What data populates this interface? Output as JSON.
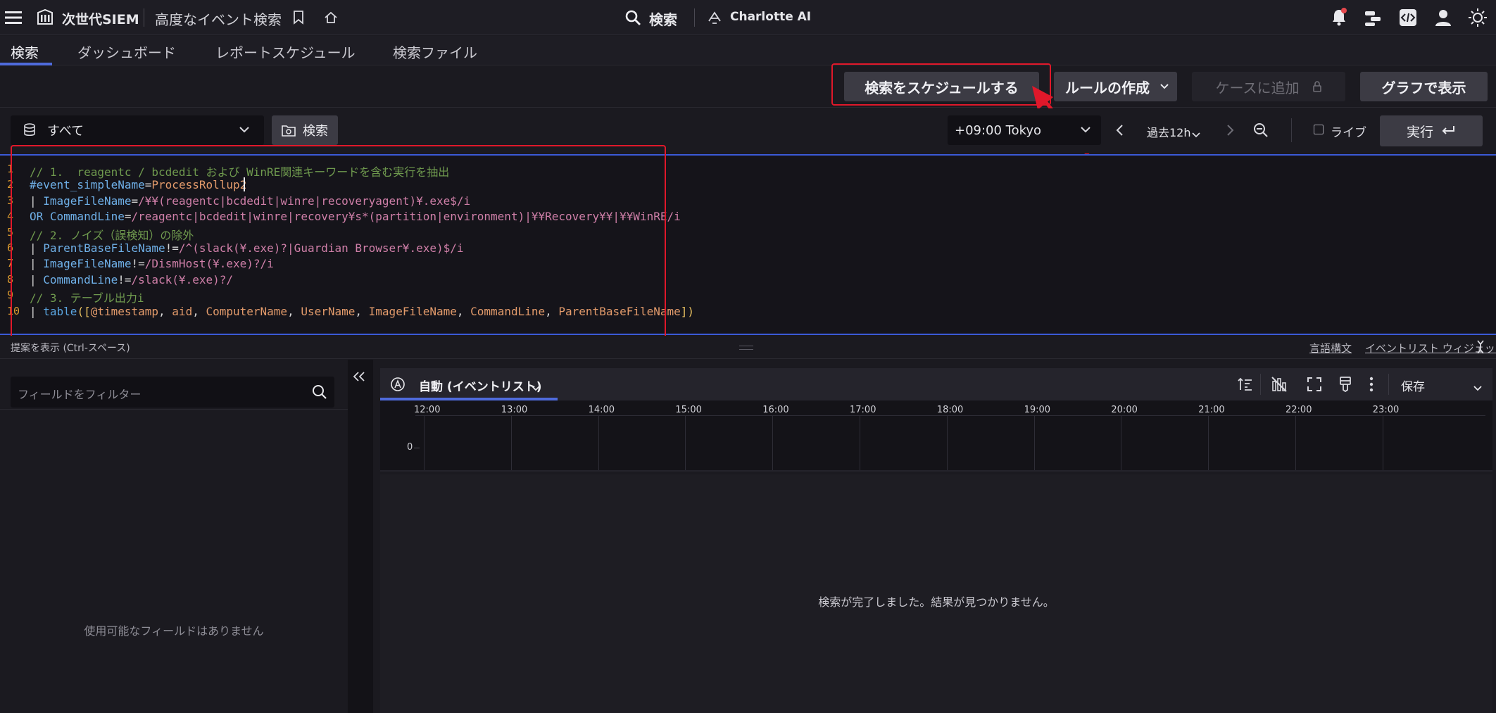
{
  "topbar": {
    "menu_icon": "hamburger-menu-icon",
    "logo_icon": "siem-logo-icon",
    "app_name": "次世代SIEM",
    "page_title": "高度なイベント検索",
    "search_label": "検索",
    "charlotte_label": "Charlotte AI"
  },
  "nav": {
    "tabs": [
      "検索",
      "ダッシュボード",
      "レポートスケジュール",
      "検索ファイル"
    ],
    "active_tab": "検索"
  },
  "actions": {
    "schedule": "検索をスケジュールする",
    "create_rule": "ルールの作成",
    "add_to_case": "ケースに追加",
    "show_graph": "グラフで表示"
  },
  "query": {
    "repo_select": "すべて",
    "search_button": "検索",
    "timezone": "+09:00 Tokyo",
    "time_range": "過去12h",
    "live_label": "ライブ",
    "run_button": "実行"
  },
  "editor": {
    "lines": [
      {
        "n": "1",
        "parts": [
          [
            "c-comment",
            "// 1.  reagentc / bcdedit および WinRE関連キーワードを含む実行を抽出"
          ]
        ]
      },
      {
        "n": "2",
        "parts": [
          [
            "c-field",
            "#event_simpleName"
          ],
          [
            "c-op",
            "="
          ],
          [
            "c-arg",
            "ProcessRollup2"
          ]
        ]
      },
      {
        "n": "3",
        "parts": [
          [
            "c-op",
            "| "
          ],
          [
            "c-field",
            "ImageFileName"
          ],
          [
            "c-op",
            "="
          ],
          [
            "c-str",
            "/¥¥(reagentc|bcdedit|winre|recoveryagent)¥.exe$/i"
          ]
        ]
      },
      {
        "n": "4",
        "parts": [
          [
            "c-field",
            "OR CommandLine"
          ],
          [
            "c-op",
            "="
          ],
          [
            "c-str",
            "/reagentc|bcdedit|winre|recovery¥s*(partition|environment)|¥¥Recovery¥¥|¥¥WinRE/i"
          ]
        ]
      },
      {
        "n": "5",
        "parts": [
          [
            "c-comment",
            "// 2. ノイズ（誤検知）の除外"
          ]
        ]
      },
      {
        "n": "6",
        "parts": [
          [
            "c-op",
            "| "
          ],
          [
            "c-field",
            "ParentBaseFileName"
          ],
          [
            "c-op",
            "!="
          ],
          [
            "c-str",
            "/^(slack(¥.exe)?|Guardian Browser¥.exe)$/i"
          ]
        ]
      },
      {
        "n": "7",
        "parts": [
          [
            "c-op",
            "| "
          ],
          [
            "c-field",
            "ImageFileName"
          ],
          [
            "c-op",
            "!="
          ],
          [
            "c-str",
            "/DismHost(¥.exe)?/i"
          ]
        ]
      },
      {
        "n": "8",
        "parts": [
          [
            "c-op",
            "| "
          ],
          [
            "c-field",
            "CommandLine"
          ],
          [
            "c-op",
            "!="
          ],
          [
            "c-str",
            "/slack(¥.exe)?/"
          ]
        ]
      },
      {
        "n": "9",
        "parts": [
          [
            "c-comment",
            "// 3. テーブル出力i"
          ]
        ]
      },
      {
        "n": "10",
        "parts": [
          [
            "c-op",
            "| "
          ],
          [
            "c-fn",
            "table"
          ],
          [
            "c-paren",
            "(["
          ],
          [
            "c-arg",
            "@timestamp"
          ],
          [
            "c-op",
            ", "
          ],
          [
            "c-arg",
            "aid"
          ],
          [
            "c-op",
            ", "
          ],
          [
            "c-arg",
            "ComputerName"
          ],
          [
            "c-op",
            ", "
          ],
          [
            "c-arg",
            "UserName"
          ],
          [
            "c-op",
            ", "
          ],
          [
            "c-arg",
            "ImageFileName"
          ],
          [
            "c-op",
            ", "
          ],
          [
            "c-arg",
            "CommandLine"
          ],
          [
            "c-op",
            ", "
          ],
          [
            "c-arg",
            "ParentBaseFileName"
          ],
          [
            "c-paren",
            "])"
          ]
        ]
      }
    ]
  },
  "suggest": {
    "hint": "提案を表示 (Ctrl-スペース)",
    "syntax_link": "言語構文",
    "widget_link": "イベントリスト ウィジェット"
  },
  "fields": {
    "filter_placeholder": "フィールドをフィルター",
    "empty_message": "使用可能なフィールドはありません"
  },
  "results": {
    "widget_label": "自動 (イベントリスト)",
    "save_label": "保存",
    "y_zero": "0",
    "hours": [
      "12:00",
      "13:00",
      "14:00",
      "15:00",
      "16:00",
      "17:00",
      "18:00",
      "19:00",
      "20:00",
      "21:00",
      "22:00",
      "23:00"
    ],
    "empty_message": "検索が完了しました。結果が見つかりません。"
  },
  "colors": {
    "accent": "#4f6bdc",
    "highlight_red": "#e0182a",
    "notification_dot": "#e5484d"
  }
}
